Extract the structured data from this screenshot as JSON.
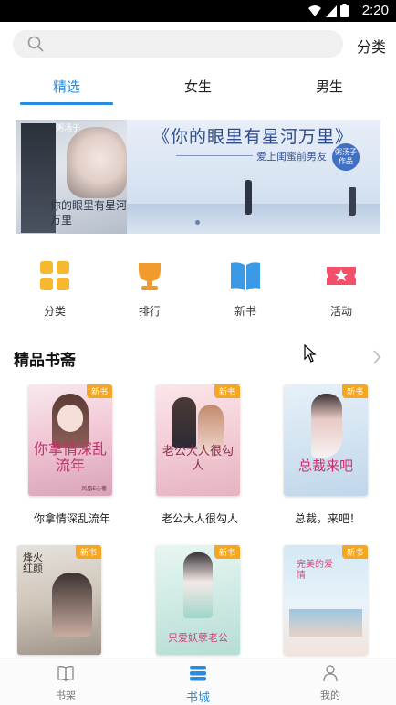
{
  "status_bar": {
    "time": "2:20"
  },
  "search": {
    "placeholder": "",
    "category_label": "分类"
  },
  "tabs": [
    {
      "label": "精选",
      "active": true
    },
    {
      "label": "女生",
      "active": false
    },
    {
      "label": "男生",
      "active": false
    }
  ],
  "banner": {
    "title": "《你的眼里有星河万里》",
    "subtitle": "爱上闺蜜前男友",
    "cover_title": "你的眼里有星河万里",
    "author_badge": "粥汤子作品",
    "cover_author": "粥汤子"
  },
  "quick_links": [
    {
      "label": "分类",
      "icon": "grid-icon",
      "color": "#f5b82e"
    },
    {
      "label": "排行",
      "icon": "trophy-icon",
      "color": "#f39a2f"
    },
    {
      "label": "新书",
      "icon": "book-open-icon",
      "color": "#3b9ae8"
    },
    {
      "label": "活动",
      "icon": "ticket-star-icon",
      "color": "#f2506a"
    }
  ],
  "section": {
    "title": "精品书斋"
  },
  "books": [
    {
      "title": "你拿情深乱流年",
      "tag": "新书",
      "cover_text": "你拿情深乱流年",
      "cover_author": "凤凰E心著"
    },
    {
      "title": "老公大人很勾人",
      "tag": "新书",
      "cover_text": "老公大人很勾人"
    },
    {
      "title": "总裁，来吧！",
      "tag": "新书",
      "cover_text": "总裁来吧"
    },
    {
      "title": "",
      "tag": "新书",
      "cover_text": "烽火红颜"
    },
    {
      "title": "",
      "tag": "新书",
      "cover_text": "只爱妖孽老公"
    },
    {
      "title": "",
      "tag": "新书",
      "cover_text": "完美的爱情"
    }
  ],
  "bottom_nav": [
    {
      "label": "书架",
      "icon": "bookshelf-icon",
      "active": false
    },
    {
      "label": "书城",
      "icon": "store-icon",
      "active": true
    },
    {
      "label": "我的",
      "icon": "user-icon",
      "active": false
    }
  ],
  "colors": {
    "accent": "#2a8be0",
    "new_tag": "#f5a623"
  }
}
